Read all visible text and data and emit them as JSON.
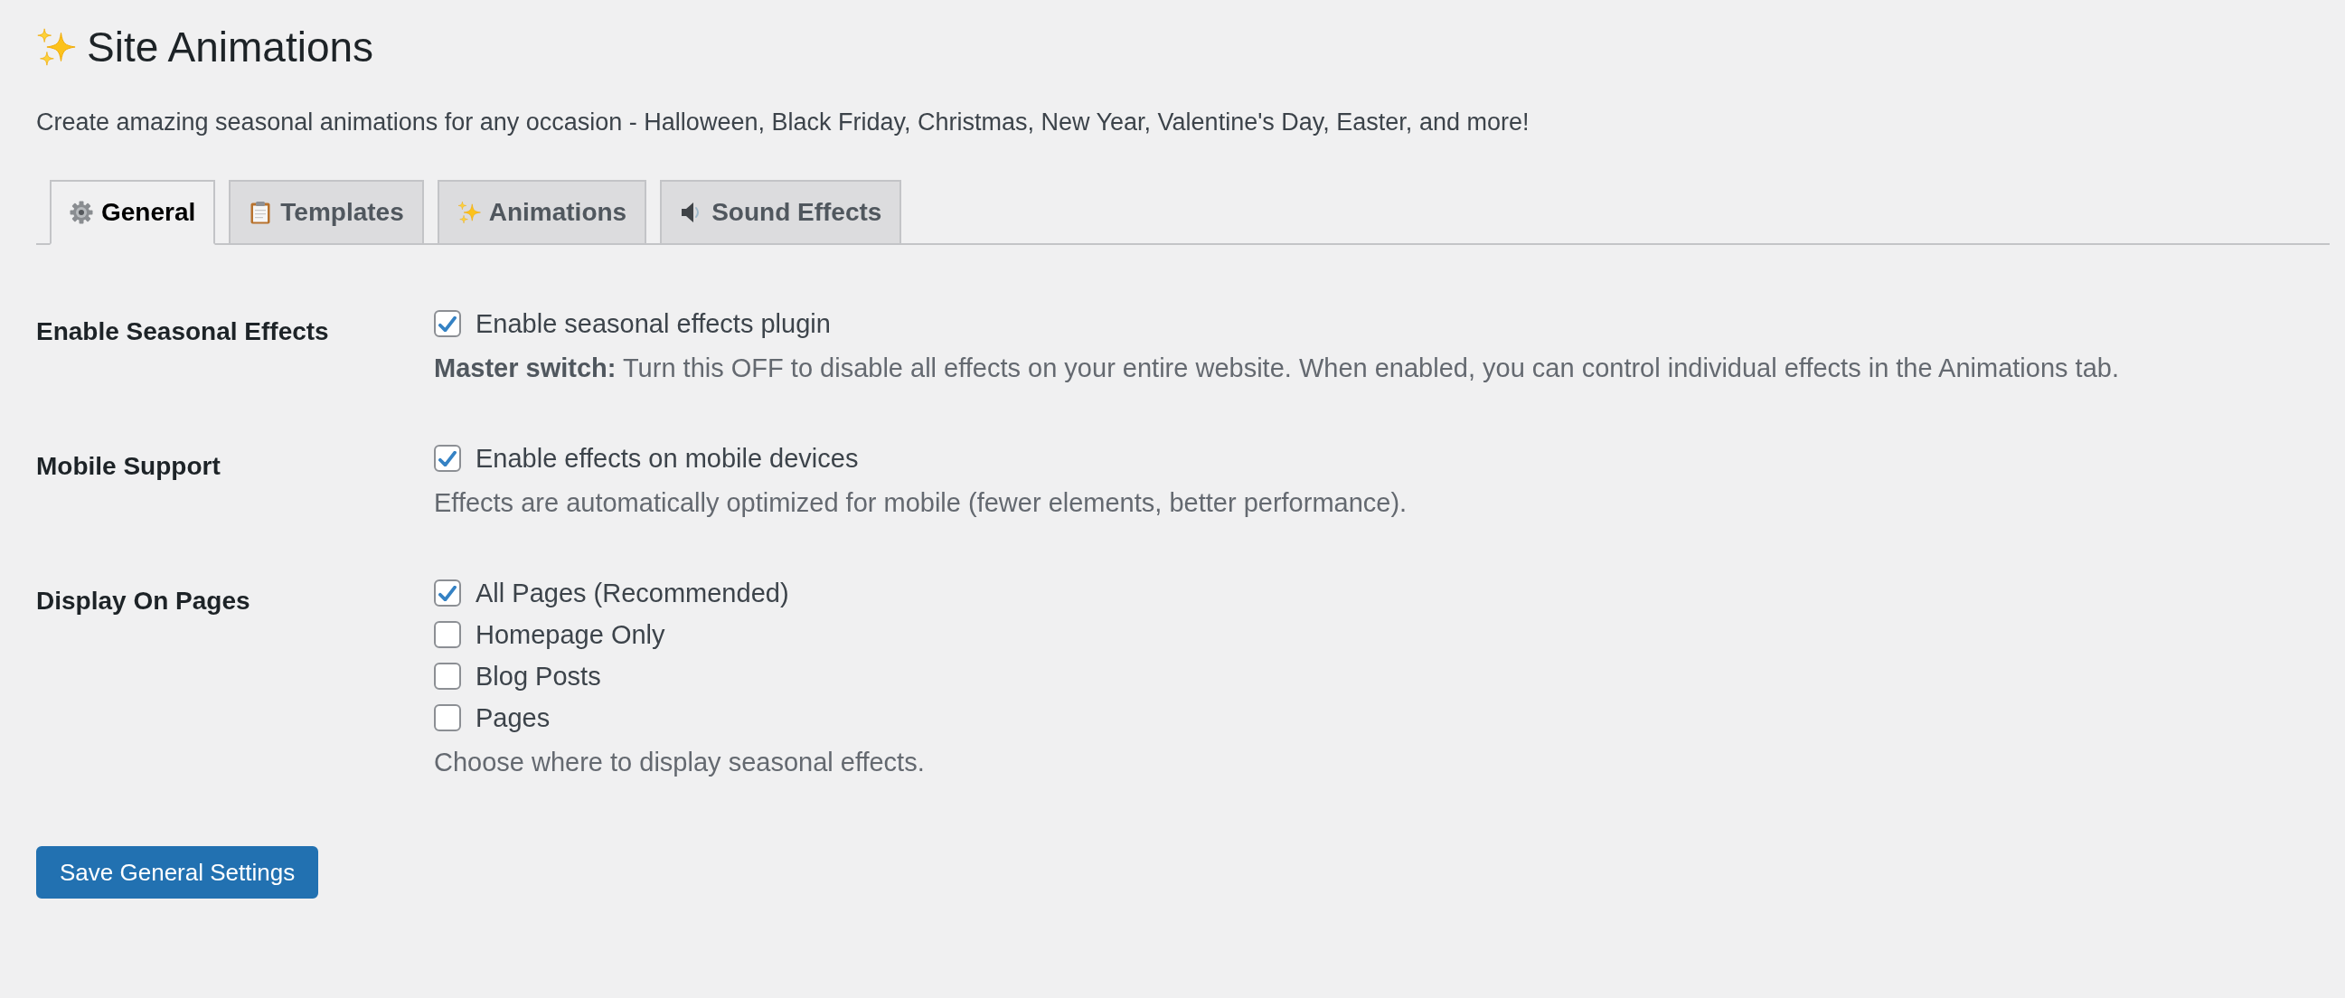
{
  "header": {
    "title": "Site Animations",
    "description": "Create amazing seasonal animations for any occasion - Halloween, Black Friday, Christmas, New Year, Valentine's Day, Easter, and more!"
  },
  "tabs": [
    {
      "label": "General",
      "selected": true
    },
    {
      "label": "Templates",
      "selected": false
    },
    {
      "label": "Animations",
      "selected": false
    },
    {
      "label": "Sound Effects",
      "selected": false
    }
  ],
  "settings": [
    {
      "label": "Enable Seasonal Effects",
      "options": [
        {
          "label": "Enable seasonal effects plugin",
          "checked": true
        }
      ],
      "description": "**Master switch:** Turn this OFF to disable all effects on your entire website. When enabled, you can control individual effects in the Animations tab."
    },
    {
      "label": "Mobile Support",
      "options": [
        {
          "label": "Enable effects on mobile devices",
          "checked": true
        }
      ],
      "description": "Effects are automatically optimized for mobile (fewer elements, better performance)."
    },
    {
      "label": "Display On Pages",
      "options": [
        {
          "label": "All Pages (Recommended)",
          "checked": true
        },
        {
          "label": "Homepage Only",
          "checked": false
        },
        {
          "label": "Blog Posts",
          "checked": false
        },
        {
          "label": "Pages",
          "checked": false
        }
      ],
      "description": "Choose where to display seasonal effects."
    }
  ],
  "save_button": {
    "label": "Save General Settings"
  }
}
